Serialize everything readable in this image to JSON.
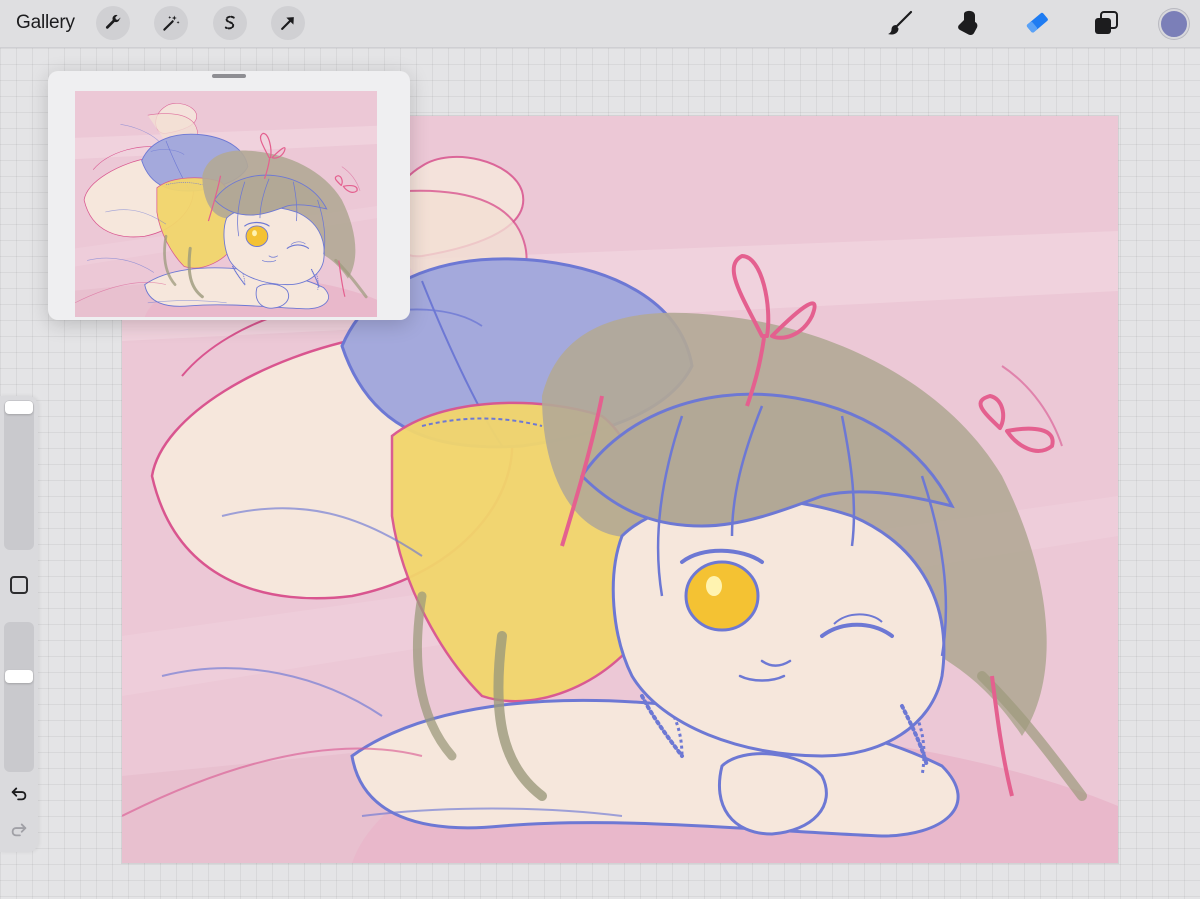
{
  "toolbar": {
    "gallery_label": "Gallery",
    "left_tools": [
      "wrench-icon",
      "magic-wand-icon",
      "selection-s-icon",
      "transform-arrow-icon"
    ],
    "right_tools": [
      "brush-icon",
      "smudge-icon",
      "eraser-icon",
      "layers-icon"
    ],
    "active_tool": "eraser-icon",
    "current_color": "#7b7fb8"
  },
  "sidebar": {
    "brush_size_level": 0.0,
    "opacity_level": 0.35,
    "icons": [
      "modify-square-icon",
      "undo-icon",
      "redo-icon"
    ]
  },
  "reference_window": {
    "visible": true
  },
  "colors": {
    "accent": "#1f7cf2",
    "canvas_background": "#ecc8d6",
    "line_blue": "#6d78d4",
    "line_pink": "#d9558f",
    "skin": "#f6e7dc",
    "hair": "#b2a896",
    "shorts": "#a4a9dc",
    "top_yellow": "#f2d66c",
    "eye_yellow": "#f4c233",
    "ribbon": "#e4608f"
  }
}
